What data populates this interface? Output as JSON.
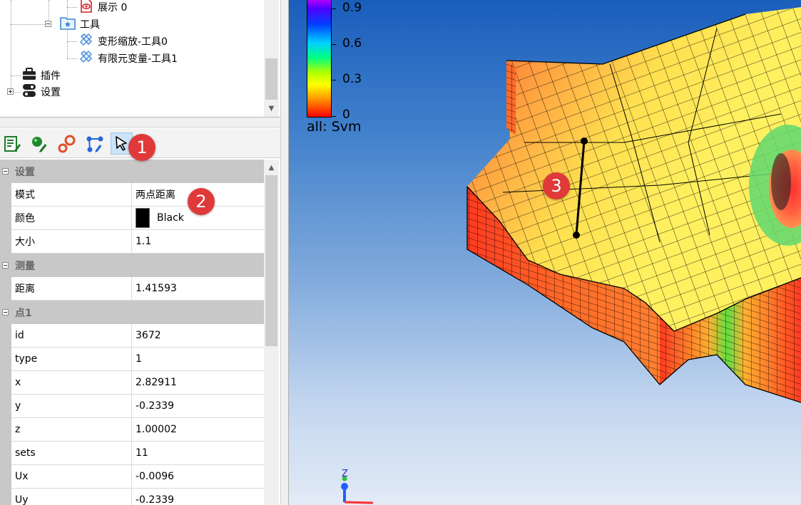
{
  "tree": {
    "items": [
      {
        "label": "展示 0",
        "icon": "eye-document-icon"
      },
      {
        "label": "工具",
        "icon": "folder-star-icon"
      },
      {
        "label": "变形缩放-工具0",
        "icon": "tool-icon"
      },
      {
        "label": "有限元变量-工具1",
        "icon": "tool-icon"
      },
      {
        "label": "插件",
        "icon": "toolbox-icon"
      },
      {
        "label": "设置",
        "icon": "toggle-settings-icon"
      }
    ]
  },
  "toolbar": {
    "buttons": [
      {
        "name": "edit-list-icon"
      },
      {
        "name": "add-point-icon"
      },
      {
        "name": "probe-icon"
      },
      {
        "name": "measure-angle-icon"
      },
      {
        "name": "select-cursor-icon",
        "active": true
      }
    ]
  },
  "props": {
    "cat_settings": "设置",
    "mode_label": "模式",
    "mode_value": "两点距离",
    "color_label": "颜色",
    "color_value": "Black",
    "size_label": "大小",
    "size_value": "1.1",
    "cat_measure": "测量",
    "distance_label": "距离",
    "distance_value": "1.41593",
    "cat_point": "点1",
    "rows": [
      {
        "name": "id",
        "value": "3672"
      },
      {
        "name": "type",
        "value": "1"
      },
      {
        "name": "x",
        "value": "2.82911"
      },
      {
        "name": "y",
        "value": "-0.2339"
      },
      {
        "name": "z",
        "value": "1.00002"
      },
      {
        "name": "sets",
        "value": "11"
      },
      {
        "name": "Ux",
        "value": "-0.0096"
      },
      {
        "name": "Uy",
        "value": "-0.2339"
      }
    ]
  },
  "legend": {
    "ticks": [
      "0.9",
      "0.6",
      "0.3",
      "0"
    ],
    "caption": "all: Svm"
  },
  "badges": {
    "b1": "1",
    "b2": "2",
    "b3": "3"
  },
  "axis": {
    "z_label": "Z"
  }
}
